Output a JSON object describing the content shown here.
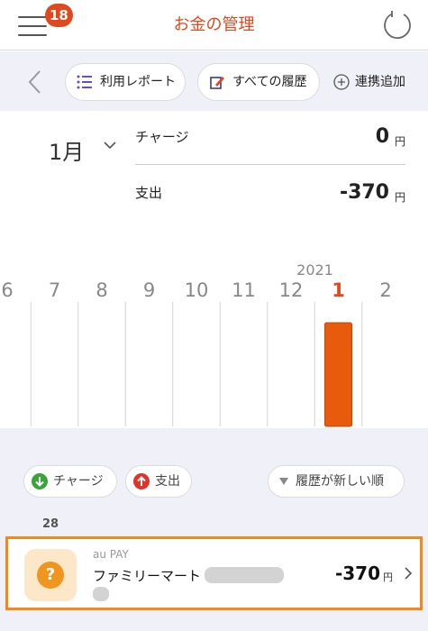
{
  "header": {
    "title": "お金の管理",
    "notification_count": "18",
    "menu_icon": "hamburger-menu-icon",
    "refresh_icon": "refresh-icon",
    "accent_color": "#e0481e"
  },
  "toolbar": {
    "back_icon": "chevron-left-icon",
    "report_label": "利用レポート",
    "history_label": "すべての履歴",
    "add_label": "連携追加"
  },
  "summary": {
    "month_label": "1月",
    "charge_label": "チャージ",
    "charge_amount": "0",
    "charge_unit": "円",
    "spend_label": "支出",
    "spend_amount": "-370",
    "spend_unit": "円"
  },
  "chart_data": {
    "type": "bar",
    "year_label": "2021",
    "categories": [
      "6",
      "7",
      "8",
      "9",
      "10",
      "11",
      "12",
      "1",
      "2"
    ],
    "values": [
      0,
      0,
      0,
      0,
      0,
      0,
      0,
      370,
      0
    ],
    "selected_category": "1",
    "bar_color": "#e85a0c",
    "selected_label_color": "#e0481e"
  },
  "filters": {
    "charge_label": "チャージ",
    "spend_label": "支出",
    "sort_label": "履歴が新しい順"
  },
  "transactions": {
    "date": "28",
    "items": [
      {
        "source": "au PAY",
        "merchant": "ファミリーマート",
        "amount": "-370",
        "unit": "円",
        "icon": "question-icon"
      }
    ]
  }
}
